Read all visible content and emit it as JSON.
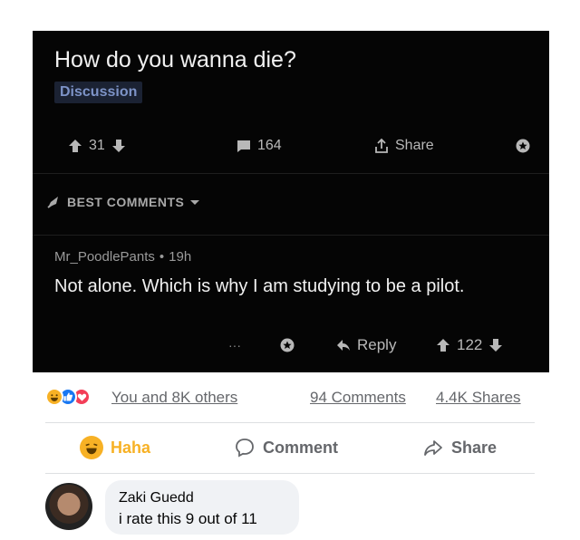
{
  "reddit": {
    "post_title": "How do you wanna die?",
    "flair": "Discussion",
    "post_actions": {
      "votes": "31",
      "comments": "164",
      "share_label": "Share"
    },
    "sort_label": "BEST COMMENTS",
    "comment": {
      "author": "Mr_PoodlePants",
      "separator": "•",
      "age": "19h",
      "body": "Not alone.  Which is why I am studying to be a pilot.",
      "more": "···",
      "reply_label": "Reply",
      "votes": "122"
    }
  },
  "facebook": {
    "reactions_text": "You and 8K others",
    "comments_count": "94 Comments",
    "shares_count": "4.4K Shares",
    "buttons": {
      "haha": "Haha",
      "comment": "Comment",
      "share": "Share"
    },
    "reply": {
      "name": "Zaki Guedd",
      "text": "i rate this 9 out of 11"
    }
  },
  "colors": {
    "reddit_bg": "#050505",
    "flair_text": "#7d93c7",
    "haha": "#f7b125",
    "like": "#1877f2",
    "love": "#f33e58"
  },
  "icons": [
    "upvote-icon",
    "downvote-icon",
    "comment-icon",
    "share-icon",
    "award-icon",
    "rocket-icon",
    "chevron-down-icon",
    "reply-icon",
    "haha-icon",
    "like-icon",
    "love-icon",
    "comment-bubble-icon",
    "share-arrow-icon"
  ]
}
